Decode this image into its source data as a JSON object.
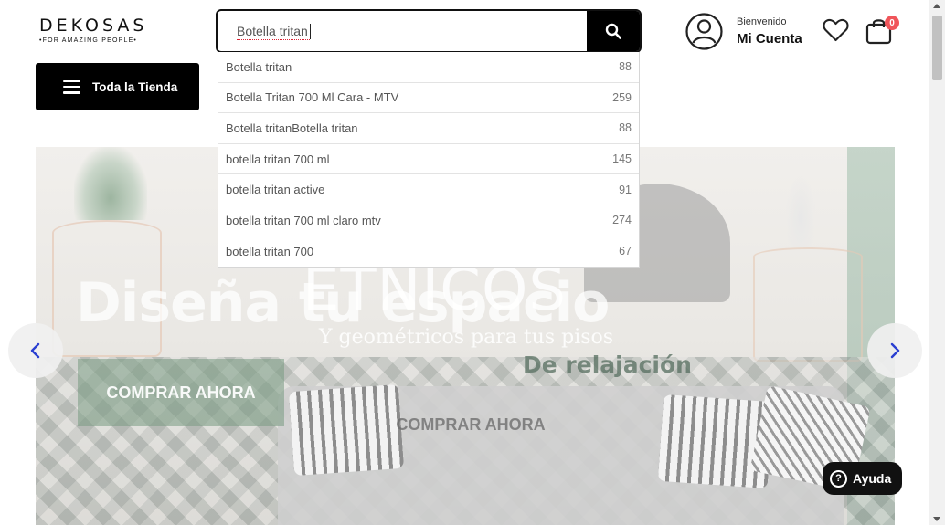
{
  "header": {
    "logo_word": "DEKOSAS",
    "logo_tagline": "•FOR AMAZING PEOPLE•",
    "search": {
      "value": "Botella tritan",
      "button_icon": "search-icon"
    },
    "account": {
      "greeting": "Bienvenido",
      "label": "Mi Cuenta",
      "icon": "user-circle-icon"
    },
    "wishlist_icon": "heart-icon",
    "cart": {
      "icon": "shopping-bag-icon",
      "count": "0"
    },
    "all_store": {
      "label": "Toda la Tienda",
      "icon": "hamburger-icon"
    }
  },
  "suggestions": [
    {
      "text": "Botella tritan",
      "count": "88"
    },
    {
      "text": "Botella Tritan 700 Ml Cara - MTV",
      "count": "259"
    },
    {
      "text": "Botella tritanBotella tritan",
      "count": "88"
    },
    {
      "text": "botella tritan 700 ml",
      "count": "145"
    },
    {
      "text": "botella tritan active",
      "count": "91"
    },
    {
      "text": "botella tritan 700 ml claro mtv",
      "count": "274"
    },
    {
      "text": "botella tritan 700",
      "count": "67"
    }
  ],
  "banner": {
    "headline_a": "Diseña tu espacio",
    "headline_b": "ETNICOS",
    "subtitle_a": "Y geométricos para tus pisos",
    "subtitle_b": "De relajación",
    "cta_a": "COMPRAR AHORA",
    "cta_b": "COMPRAR AHORA",
    "prev_icon": "chevron-left-icon",
    "next_icon": "chevron-right-icon"
  },
  "help": {
    "label": "Ayuda",
    "icon_glyph": "?"
  },
  "colors": {
    "accent_black": "#000000",
    "badge_red": "#f0555a",
    "chevron_blue": "#2a3fd1"
  }
}
